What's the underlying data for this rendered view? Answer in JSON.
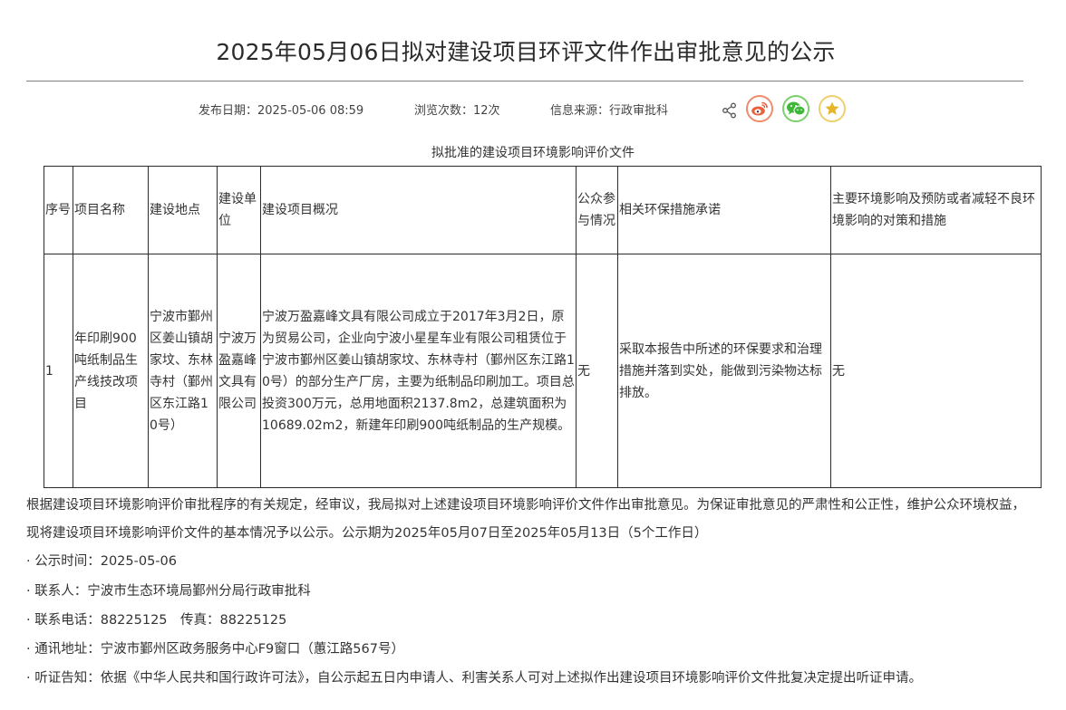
{
  "title": "2025年05月06日拟对建设项目环评文件作出审批意见的公示",
  "meta": {
    "publish_label": "发布日期：",
    "publish_value": "2025-05-06 08:59",
    "views_label": "浏览次数：",
    "views_value": "12次",
    "source_label": "信息来源：",
    "source_value": "行政审批科"
  },
  "share": {
    "icons": [
      "share-icon",
      "weibo-icon",
      "wechat-icon",
      "favorite-star-icon"
    ],
    "colors": {
      "weibo": "#e8603c",
      "wechat": "#3fb83a",
      "favorite": "#e5b52a"
    }
  },
  "table": {
    "caption": "拟批准的建设项目环境影响评价文件",
    "headers": [
      "序号",
      "项目名称",
      "建设地点",
      "建设单位",
      "建设项目概况",
      "公众参与情况",
      "相关环保措施承诺",
      "主要环境影响及预防或者减轻不良环境影响的对策和措施"
    ],
    "rows": [
      [
        "1",
        "年印刷900吨纸制品生产线技改项目",
        "宁波市鄞州区姜山镇胡家坟、东林寺村（鄞州区东江路10号）",
        "宁波万盈嘉峰文具有限公司",
        "宁波万盈嘉峰文具有限公司成立于2017年3月2日，原为贸易公司，企业向宁波小星星车业有限公司租赁位于宁波市鄞州区姜山镇胡家坟、东林寺村（鄞州区东江路10号）的部分生产厂房，主要为纸制品印刷加工。项目总投资300万元，总用地面积2137.8m2，总建筑面积为10689.02m2，新建年印刷900吨纸制品的生产规模。",
        "无",
        "采取本报告中所述的环保要求和治理措施并落到实处，能做到污染物达标排放。",
        "无"
      ]
    ]
  },
  "notice": {
    "paragraph": "根据建设项目环境影响评价审批程序的有关规定，经审议，我局拟对上述建设项目环境影响评价文件作出审批意见。为保证审批意见的严肃性和公正性，维护公众环境权益，现将建设项目环境影响评价文件的基本情况予以公示。公示期为2025年05月07日至2025年05月13日（5个工作日）",
    "items": [
      "· 公示时间：2025-05-06",
      "· 联系人：宁波市生态环境局鄞州分局行政审批科",
      "· 联系电话：88225125　传真：88225125",
      "· 通讯地址：宁波市鄞州区政务服务中心F9窗口（蕙江路567号）",
      "· 听证告知：依据《中华人民共和国行政许可法》，自公示起五日内申请人、利害关系人可对上述拟作出建设项目环境影响评价文件批复决定提出听证申请。"
    ]
  }
}
